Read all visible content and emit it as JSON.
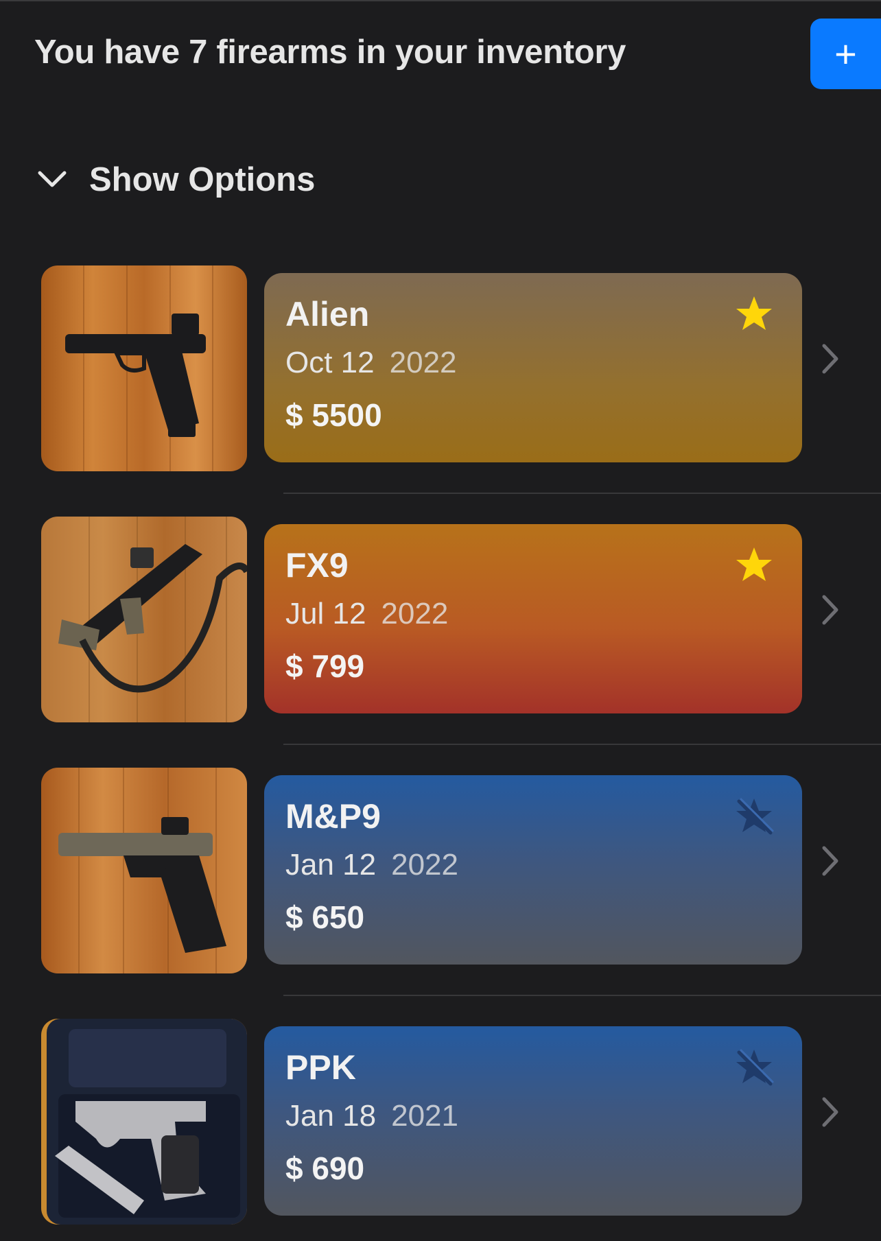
{
  "header": {
    "title": "You have 7 firearms in your inventory",
    "add_label": "+",
    "add_color": "#0a7aff"
  },
  "options": {
    "label": "Show Options",
    "icon": "chevron-down-icon"
  },
  "items": [
    {
      "name": "Alien",
      "date": "Oct 12",
      "year": "2022",
      "price": "$ 5500",
      "favorite": true,
      "thumbnail": "pistol-on-wood-photo"
    },
    {
      "name": "FX9",
      "date": "Jul 12",
      "year": "2022",
      "price": "$ 799",
      "favorite": true,
      "thumbnail": "carbine-with-sling-on-wood-photo"
    },
    {
      "name": "M&P9",
      "date": "Jan 12",
      "year": "2022",
      "price": "$ 650",
      "favorite": false,
      "thumbnail": "pistol-on-wood-photo"
    },
    {
      "name": "PPK",
      "date": "Jan 18",
      "year": "2021",
      "price": "$ 690",
      "favorite": false,
      "thumbnail": "pistol-in-case-photo"
    }
  ],
  "colors": {
    "background": "#1c1c1e",
    "favorite_star": "#ffd60a",
    "unfavorite_star": "#1f3b6a"
  }
}
